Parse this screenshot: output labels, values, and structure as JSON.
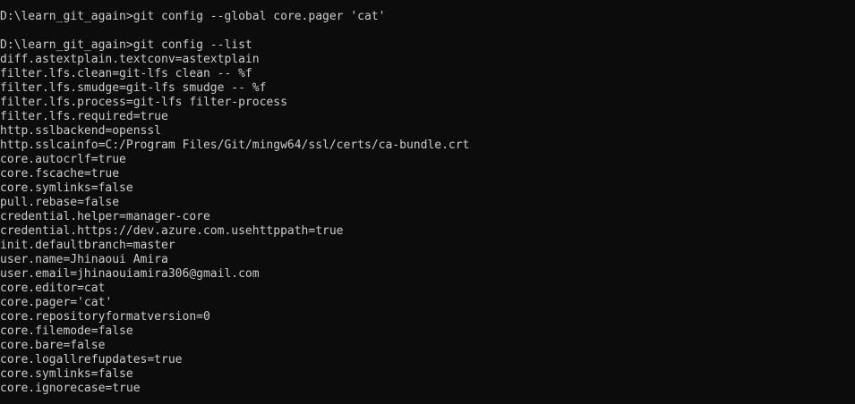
{
  "terminal": {
    "lines": [
      "D:\\learn_git_again>git config --global core.pager 'cat'",
      "",
      "D:\\learn_git_again>git config --list",
      "diff.astextplain.textconv=astextplain",
      "filter.lfs.clean=git-lfs clean -- %f",
      "filter.lfs.smudge=git-lfs smudge -- %f",
      "filter.lfs.process=git-lfs filter-process",
      "filter.lfs.required=true",
      "http.sslbackend=openssl",
      "http.sslcainfo=C:/Program Files/Git/mingw64/ssl/certs/ca-bundle.crt",
      "core.autocrlf=true",
      "core.fscache=true",
      "core.symlinks=false",
      "pull.rebase=false",
      "credential.helper=manager-core",
      "credential.https://dev.azure.com.usehttppath=true",
      "init.defaultbranch=master",
      "user.name=Jhinaoui Amira",
      "user.email=jhinaouiamira306@gmail.com",
      "core.editor=cat",
      "core.pager='cat'",
      "core.repositoryformatversion=0",
      "core.filemode=false",
      "core.bare=false",
      "core.logallrefupdates=true",
      "core.symlinks=false",
      "core.ignorecase=true"
    ]
  }
}
